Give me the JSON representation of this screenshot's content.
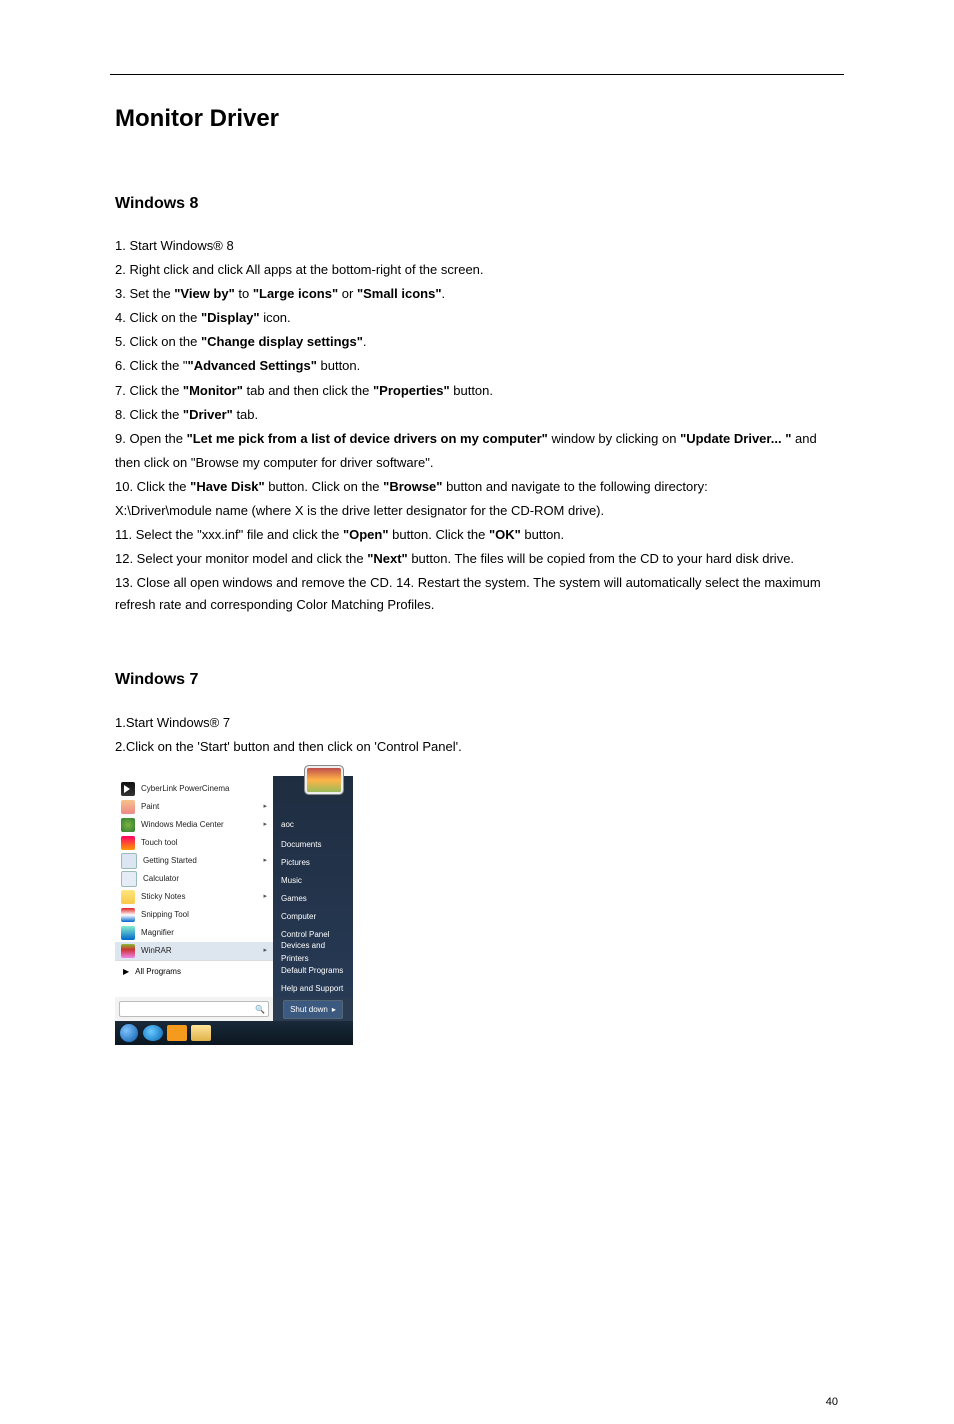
{
  "section": {
    "title": "Monitor Driver"
  },
  "sub": {
    "win8": "Windows 8",
    "win7": "Windows 7"
  },
  "q": {
    "viewby": "\"View by\"",
    "largeicons": "\"Large icons\"",
    "smallicons": "\"Small icons\"",
    "display_quoted": "\"Display\"",
    "changedisplay": "\"Change display settings\"",
    "advsettings": "\"Advanced Settings\"",
    "monitor": "\"Monitor\"",
    "properties": "\"Properties\"",
    "driver": "\"Driver\"",
    "letmepick": "\"Let me pick from a list of device drivers on my computer\"",
    "updatedriver": "\"Update Driver... \"",
    "havedisk": "\"Have Disk\"",
    "browse": "\"Browse\"",
    "open": "\"Open\"",
    "ok": "\"OK\"",
    "next": "\"Next\""
  },
  "s8": {
    "l0": "1. Start Windows® 8",
    "l1": "2. Right click and click All apps at the bottom-right of the screen.",
    "l2a": "3. Set the ",
    "l2b": " to ",
    "or": " or ",
    "period": ".",
    "l3a": "4. Click on the ",
    "l3b": " icon.",
    "l4a": "5. Click on the ",
    "l5a": "6. Click the \"",
    "l5b": " button.",
    "l6a": "7. Click the ",
    "l6b": " tab and then click the ",
    "l6c": " button.",
    "l7a": "8. Click the ",
    "l7b": " tab.",
    "l8a": "9. Open the ",
    "l8b": " window by clicking on ",
    "l8c": " and",
    "l8d": "then click on \"Browse my computer for driver software\".",
    "l9a": "10. Click the ",
    "l9b": " button. Click on the ",
    "l9c": " button and navigate to the following directory:",
    "l9d": "X:\\Driver\\module name (where X is the drive letter designator for the CD-ROM drive).",
    "l10a": "11. Select the \"xxx.inf\" file and click the ",
    "l10b": " button. Click the ",
    "l10c": " button.",
    "l11a": "12. Select your monitor model and click the ",
    "l11b": " button. The files will be copied from the CD to your hard disk drive.",
    "l12": "13. Close all open windows and remove the CD.\n14. Restart the system. The system will automatically select the maximum refresh rate and corresponding Color Matching Profiles."
  },
  "s7": {
    "l0": "1.Start Windows® 7",
    "l1": "2.Click on the 'Start' button and then click on 'Control Panel'."
  },
  "menu": {
    "account": "aoc",
    "left": [
      "CyberLink PowerCinema",
      "Paint",
      "Windows Media Center",
      "Touch tool",
      "Getting Started",
      "Calculator",
      "Sticky Notes",
      "Snipping Tool",
      "Magnifier",
      "WinRAR"
    ],
    "allPrograms": "All Programs",
    "right": [
      "Documents",
      "Pictures",
      "Music",
      "Games",
      "Computer",
      "Control Panel",
      "Devices and Printers",
      "Default Programs",
      "Help and Support"
    ],
    "shutdown": "Shut down"
  },
  "pageNumber": "40"
}
